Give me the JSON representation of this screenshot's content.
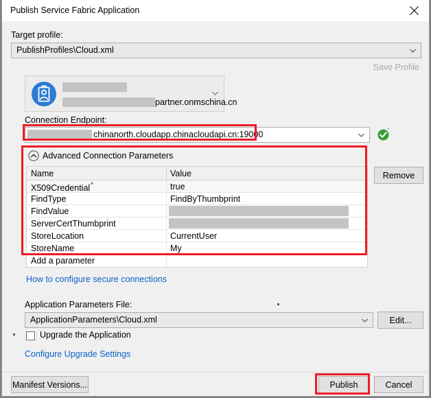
{
  "window": {
    "title": "Publish Service Fabric Application",
    "close_icon": "close-icon"
  },
  "target_profile": {
    "label": "Target profile:",
    "value": "PublishProfiles\\Cloud.xml",
    "save_profile_label": "Save Profile"
  },
  "account": {
    "domain_text": "partner.onmschina.cn",
    "avatar_icon": "user-badge-icon",
    "redacted_line1": "",
    "redacted_line2": ""
  },
  "connection_endpoint": {
    "label": "Connection Endpoint:",
    "value": "chinanorth.cloudapp.chinacloudapi.cn:19000",
    "status_icon": "green-check-icon"
  },
  "advanced": {
    "expander_label": "Advanced Connection Parameters",
    "expander_icon": "chevron-up-circle-icon",
    "columns": [
      "Name",
      "Value"
    ],
    "rows": [
      {
        "name": "X509Credential",
        "asterisk": "*",
        "value": "true",
        "redacted": false
      },
      {
        "name": "FindType",
        "value": "FindByThumbprint",
        "redacted": false
      },
      {
        "name": "FindValue",
        "value": "",
        "redacted": true
      },
      {
        "name": "ServerCertThumbprint",
        "value": "",
        "redacted": true
      },
      {
        "name": "StoreLocation",
        "value": "CurrentUser",
        "redacted": false
      },
      {
        "name": "StoreName",
        "value": "My",
        "redacted": false
      },
      {
        "name": "Add a parameter",
        "value": "",
        "redacted": false
      }
    ],
    "remove_button": "Remove"
  },
  "links": {
    "secure_connections": "How to configure secure connections",
    "configure_upgrade": "Configure Upgrade Settings"
  },
  "app_params": {
    "label": "Application Parameters File:",
    "value": "ApplicationParameters\\Cloud.xml",
    "edit_button": "Edit..."
  },
  "upgrade": {
    "checkbox_label": "Upgrade the Application",
    "checked": false
  },
  "footer": {
    "manifest_versions": "Manifest Versions...",
    "publish": "Publish",
    "cancel": "Cancel"
  },
  "colors": {
    "annotation_red": "#ee1c24",
    "link_blue": "#0a64c8",
    "accent_blue": "#2b7cd3",
    "status_green": "#30a030"
  }
}
